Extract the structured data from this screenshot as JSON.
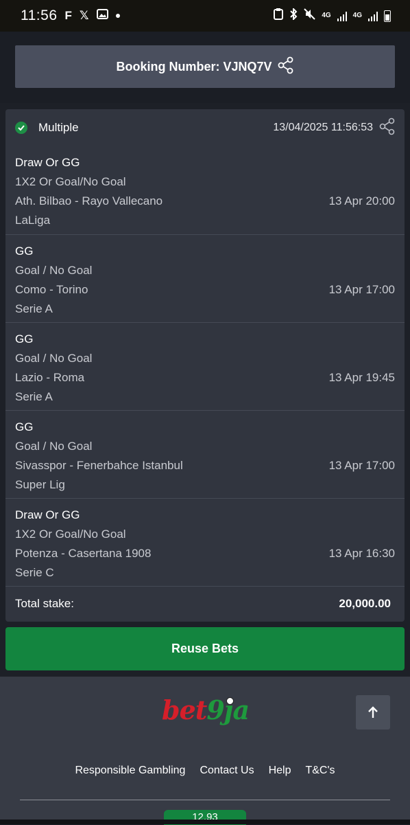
{
  "status_bar": {
    "time": "11:56",
    "network_1": "4G",
    "network_2": "4G"
  },
  "booking": {
    "label": "Booking Number: VJNQ7V"
  },
  "ticket": {
    "type": "Multiple",
    "datetime": "13/04/2025 11:56:53",
    "selections": [
      {
        "pick": "Draw Or GG",
        "market": "1X2 Or Goal/No Goal",
        "match": "Ath. Bilbao - Rayo Vallecano",
        "league": "LaLiga",
        "kickoff": "13 Apr 20:00"
      },
      {
        "pick": "GG",
        "market": "Goal / No Goal",
        "match": "Como - Torino",
        "league": "Serie A",
        "kickoff": "13 Apr 17:00"
      },
      {
        "pick": "GG",
        "market": "Goal / No Goal",
        "match": "Lazio - Roma",
        "league": "Serie A",
        "kickoff": "13 Apr 19:45"
      },
      {
        "pick": "GG",
        "market": "Goal / No Goal",
        "match": "Sivasspor - Fenerbahce Istanbul",
        "league": "Super Lig",
        "kickoff": "13 Apr 17:00"
      },
      {
        "pick": "Draw Or GG",
        "market": "1X2 Or Goal/No Goal",
        "match": "Potenza - Casertana 1908",
        "league": "Serie C",
        "kickoff": "13 Apr 16:30"
      }
    ],
    "total_label": "Total stake:",
    "total_value": "20,000.00"
  },
  "reuse_button": "Reuse Bets",
  "footer": {
    "logo_bet": "bet",
    "logo_9ja": "9ja",
    "links": [
      "Responsible Gambling",
      "Contact Us",
      "Help",
      "T&C's"
    ],
    "odds": "12.93"
  },
  "colors": {
    "accent_green": "#13853f",
    "brand_red": "#d51f2a",
    "card_bg": "#31353f"
  }
}
